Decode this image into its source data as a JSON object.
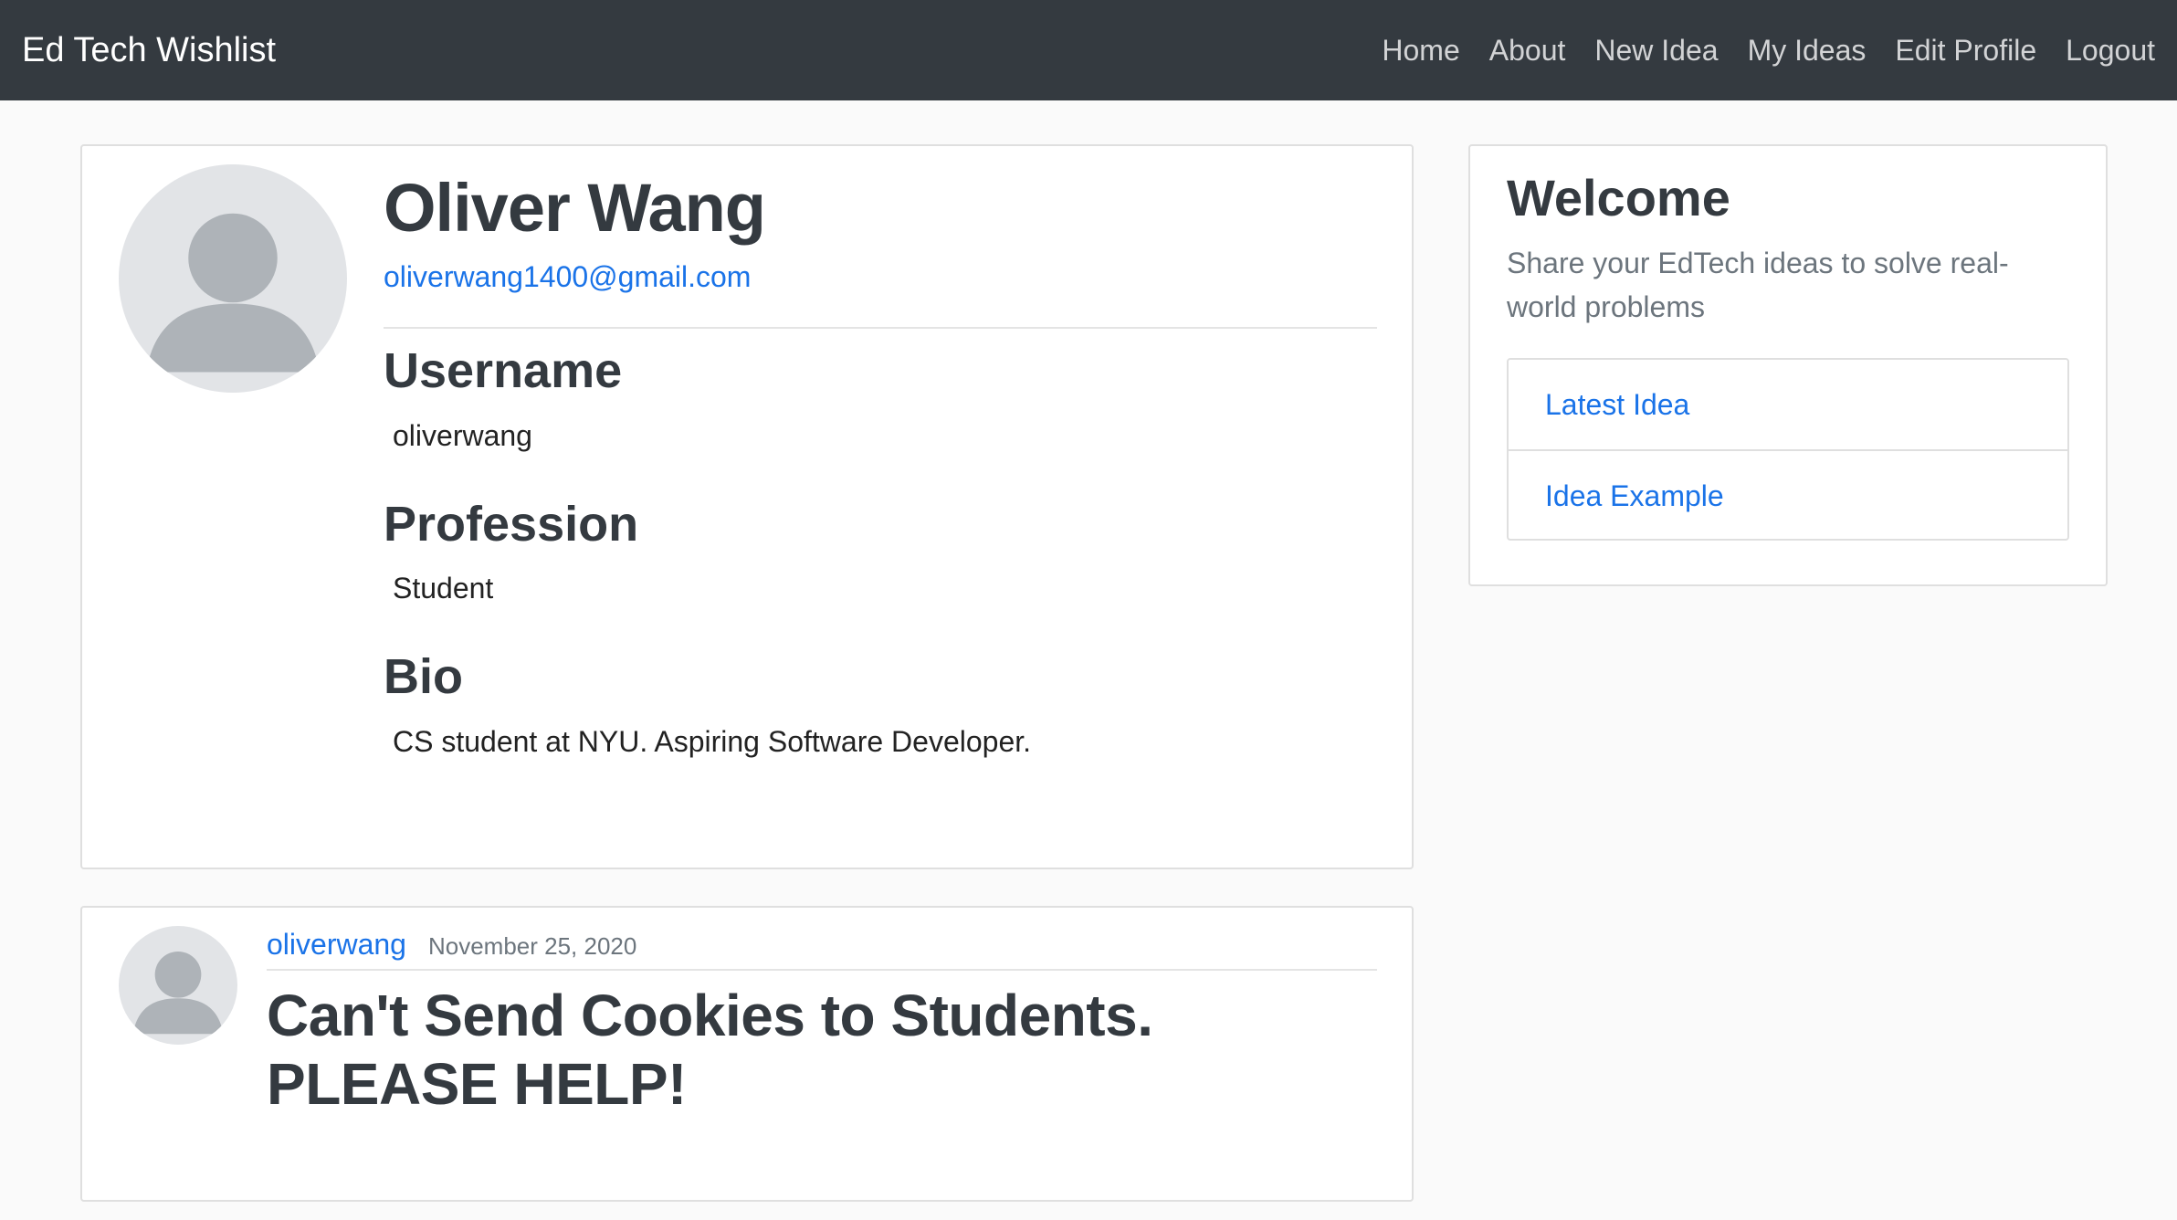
{
  "navbar": {
    "brand": "Ed Tech Wishlist",
    "links": [
      "Home",
      "About",
      "New Idea",
      "My Ideas",
      "Edit Profile",
      "Logout"
    ]
  },
  "profile": {
    "name": "Oliver Wang",
    "email": "oliverwang1400@gmail.com",
    "fields": [
      {
        "heading": "Username",
        "value": "oliverwang"
      },
      {
        "heading": "Profession",
        "value": "Student"
      },
      {
        "heading": "Bio",
        "value": "CS student at NYU. Aspiring Software Developer."
      }
    ]
  },
  "welcome": {
    "title": "Welcome",
    "text": "Share your EdTech ideas to solve real-world problems",
    "links": [
      "Latest Idea",
      "Idea Example"
    ]
  },
  "post": {
    "author": "oliverwang",
    "date": "November 25, 2020",
    "title": "Can't Send Cookies to Students. PLEASE HELP!"
  },
  "colors": {
    "navbar": "#343a40",
    "link": "#1a73e8",
    "background": "#fafafa"
  },
  "icons": {
    "avatar": "user-silhouette-icon"
  }
}
